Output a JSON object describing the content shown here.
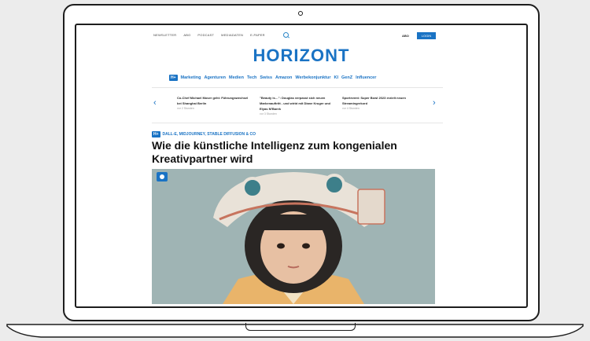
{
  "site": {
    "logo": "HORIZONT",
    "top_nav": [
      "NEWSLETTER",
      "ABO",
      "PODCAST",
      "MEDIADATEN",
      "E-PAPER"
    ],
    "abo_label": "ABO",
    "login_label": "LOGIN"
  },
  "category_nav": {
    "badge": "H+",
    "items": [
      "Marketing",
      "Agenturen",
      "Medien",
      "Tech",
      "Swiss",
      "Amazon",
      "Werbekonjunktur",
      "KI",
      "GenZ",
      "Influencer"
    ]
  },
  "teasers": [
    {
      "title": "Co-Chef Michael Moser geht: Führungswechsel bei Shanghai Berlin",
      "date": "vor 2 Stunden"
    },
    {
      "title": "\"Beauty is…\": Douglas verpasst sich neuen Markenauftritt - und wirbt mit Diane Kruger und Elyas M'Barek",
      "date": "vor 3 Stunden"
    },
    {
      "title": "Sportevent: Super Bowl 2023 erzielt neuen Streamingrekord",
      "date": "vor 4 Stunden"
    }
  ],
  "article": {
    "badge": "H+",
    "kicker": "DALL-E, MIDJOURNEY, STABLE DIFFUSION & CO",
    "headline": "Wie die künstliche Intelligenz zum kongenialen Kreativpartner wird",
    "image_alt": "Child wearing a white robotic helmet"
  },
  "colors": {
    "brand": "#1a73c4",
    "frame": "#1d1d1d",
    "background": "#ececec"
  }
}
